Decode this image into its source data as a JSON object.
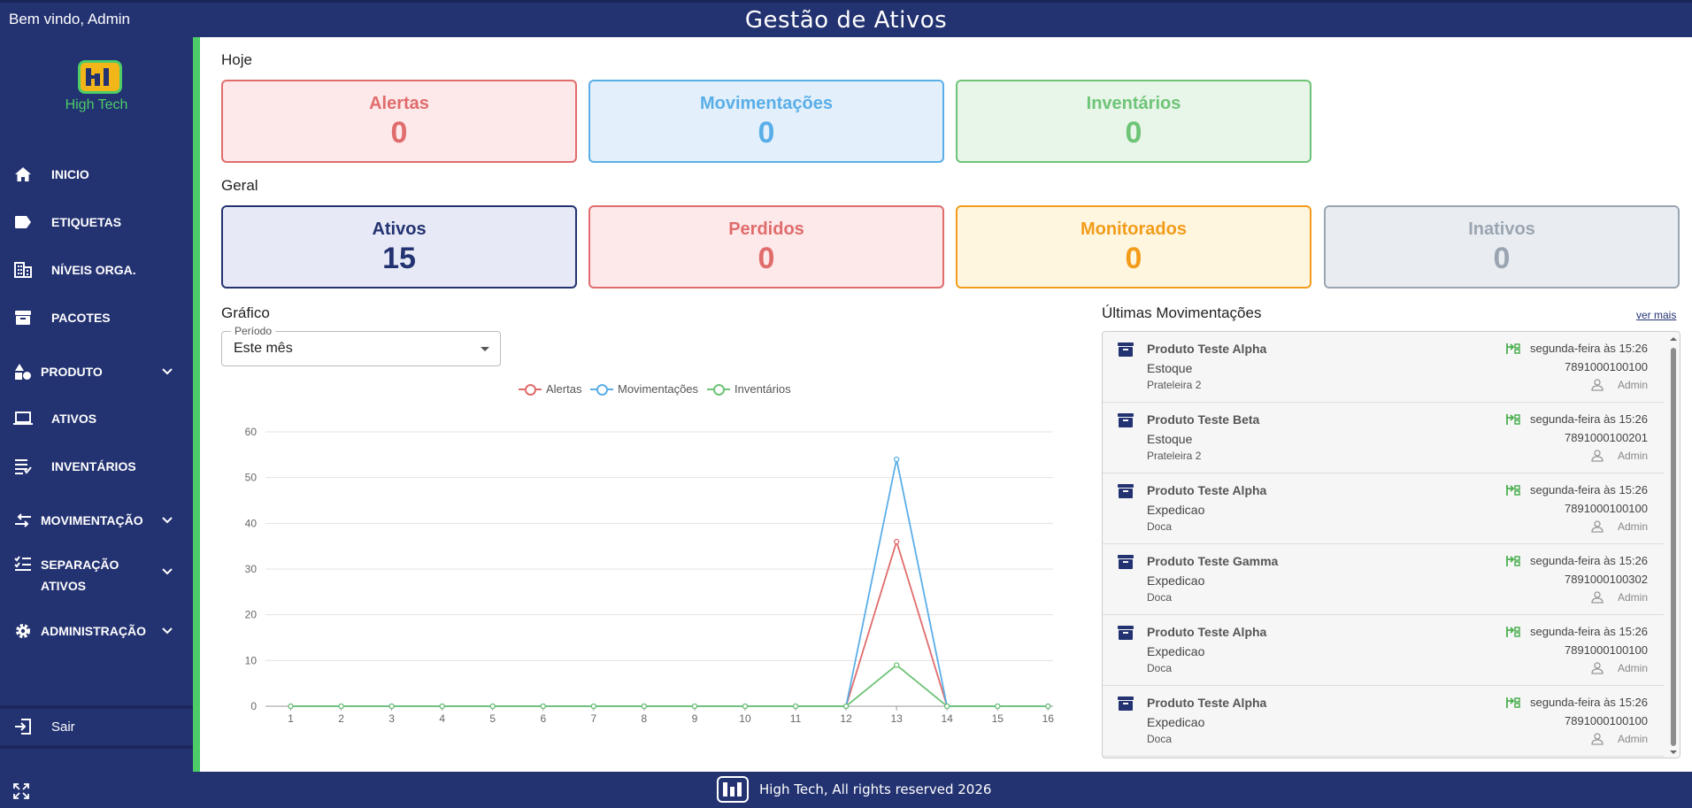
{
  "topbar": {
    "welcome": "Bem vindo, Admin",
    "title": "Gestão de Ativos"
  },
  "logo": {
    "text": "High Tech"
  },
  "sidebar": {
    "items": [
      {
        "label": "INICIO",
        "icon": "home-icon"
      },
      {
        "label": "ETIQUETAS",
        "icon": "tag-icon"
      },
      {
        "label": "NÍVEIS ORGA.",
        "icon": "building-icon"
      },
      {
        "label": "PACOTES",
        "icon": "archive-icon"
      },
      {
        "label": "PRODUTO",
        "icon": "shapes-icon"
      },
      {
        "label": "ATIVOS",
        "icon": "laptop-icon"
      },
      {
        "label": "INVENTÁRIOS",
        "icon": "list-icon"
      },
      {
        "label": "MOVIMENTAÇÃO",
        "icon": "swap-icon"
      },
      {
        "label1": "SEPARAÇÃO",
        "label2": "ATIVOS",
        "icon": "checklist-icon"
      },
      {
        "label": "ADMINISTRAÇÃO",
        "icon": "gear-icon"
      }
    ],
    "logout": "Sair"
  },
  "today": {
    "label": "Hoje",
    "cards": [
      {
        "title": "Alertas",
        "value": "0",
        "color": "#e06c6c"
      },
      {
        "title": "Movimentações",
        "value": "0",
        "color": "#5aaee8"
      },
      {
        "title": "Inventários",
        "value": "0",
        "color": "#6ec477"
      }
    ]
  },
  "general": {
    "label": "Geral",
    "cards": [
      {
        "title": "Ativos",
        "value": "15",
        "color": "#233271"
      },
      {
        "title": "Perdidos",
        "value": "0",
        "color": "#e06c6c"
      },
      {
        "title": "Monitorados",
        "value": "0",
        "color": "#f39c1a"
      },
      {
        "title": "Inativos",
        "value": "0",
        "color": "#9aa5b1"
      }
    ]
  },
  "chart_section": {
    "label": "Gráfico",
    "period_label": "Período",
    "period_value": "Este mês"
  },
  "chart_data": {
    "type": "line",
    "x": [
      1,
      2,
      3,
      4,
      5,
      6,
      7,
      8,
      9,
      10,
      11,
      12,
      13,
      14,
      15,
      16
    ],
    "ylim": [
      0,
      60
    ],
    "yticks": [
      0,
      10,
      20,
      30,
      40,
      50,
      60
    ],
    "grid": true,
    "legend_position": "top-center",
    "series": [
      {
        "name": "Alertas",
        "color": "#e06c6c",
        "values": [
          0,
          0,
          0,
          0,
          0,
          0,
          0,
          0,
          0,
          0,
          0,
          0,
          36,
          0,
          0,
          0
        ]
      },
      {
        "name": "Movimentações",
        "color": "#5aaee8",
        "values": [
          0,
          0,
          0,
          0,
          0,
          0,
          0,
          0,
          0,
          0,
          0,
          0,
          54,
          0,
          0,
          0
        ]
      },
      {
        "name": "Inventários",
        "color": "#6ec477",
        "values": [
          0,
          0,
          0,
          0,
          0,
          0,
          0,
          0,
          0,
          0,
          0,
          0,
          9,
          0,
          0,
          0
        ]
      }
    ]
  },
  "movements": {
    "title": "Últimas Movimentações",
    "see_more": "ver mais",
    "items": [
      {
        "name": "Produto Teste Alpha",
        "location": "Estoque",
        "sub": "Prateleira 2",
        "time": "segunda-feira às 15:26",
        "code": "7891000100100",
        "user": "Admin"
      },
      {
        "name": "Produto Teste Beta",
        "location": "Estoque",
        "sub": "Prateleira 2",
        "time": "segunda-feira às 15:26",
        "code": "7891000100201",
        "user": "Admin"
      },
      {
        "name": "Produto Teste Alpha",
        "location": "Expedicao",
        "sub": "Doca",
        "time": "segunda-feira às 15:26",
        "code": "7891000100100",
        "user": "Admin"
      },
      {
        "name": "Produto Teste Gamma",
        "location": "Expedicao",
        "sub": "Doca",
        "time": "segunda-feira às 15:26",
        "code": "7891000100302",
        "user": "Admin"
      },
      {
        "name": "Produto Teste Alpha",
        "location": "Expedicao",
        "sub": "Doca",
        "time": "segunda-feira às 15:26",
        "code": "7891000100100",
        "user": "Admin"
      },
      {
        "name": "Produto Teste Alpha",
        "location": "Expedicao",
        "sub": "Doca",
        "time": "segunda-feira às 15:26",
        "code": "7891000100100",
        "user": "Admin"
      }
    ]
  },
  "footer": {
    "text": "High Tech, All rights reserved 2026"
  }
}
